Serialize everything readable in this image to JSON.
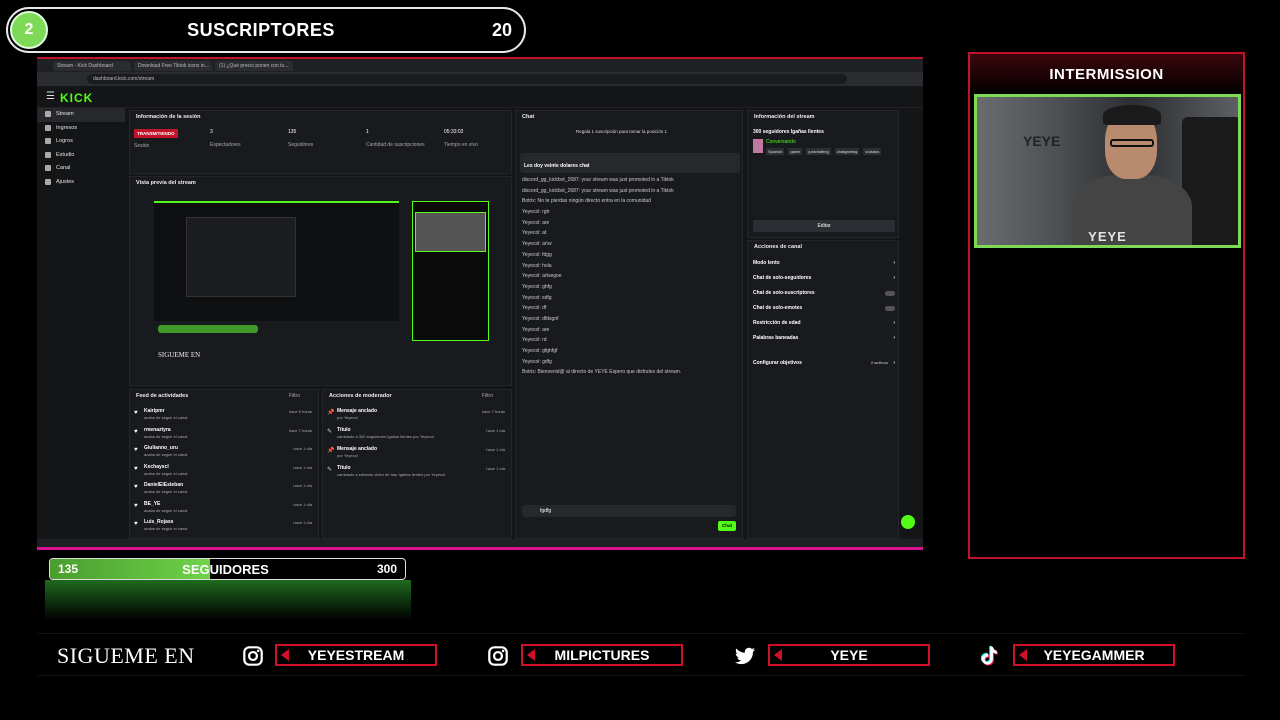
{
  "subscribers": {
    "current": "2",
    "title": "SUSCRIPTORES",
    "goal": "20"
  },
  "followers": {
    "current": "135",
    "title": "SEGUIDORES",
    "goal": "300",
    "progress_fraction": 0.45
  },
  "intermission": {
    "label": "INTERMISSION",
    "cam_brand": "YEYE"
  },
  "social": {
    "heading": "SIGUEME EN",
    "items": [
      {
        "platform_icon": "instagram-icon",
        "handle": "YEYESTREAM"
      },
      {
        "platform_icon": "instagram-icon",
        "handle": "MILPICTURES"
      },
      {
        "platform_icon": "twitter-icon",
        "handle": "YEYE"
      },
      {
        "platform_icon": "tiktok-icon",
        "handle": "YEYEGAMMER"
      }
    ]
  },
  "capture": {
    "tabs": [
      "Stream - Kick Dashboard",
      "Download Free Tiktok icons in...",
      "(1) ¿Qué precio ponen con tu..."
    ],
    "url": "dashboard.kick.com/stream",
    "logo": "KICK",
    "nav": [
      "Stream",
      "Ingresos",
      "Logros",
      "Estudio",
      "Canal",
      "Ajustes"
    ],
    "session": {
      "header": "Información de la sesión",
      "live_badge": "TRANSMITIENDO",
      "stats": [
        {
          "value": "3",
          "label": "Espectadores"
        },
        {
          "value": "135",
          "label": "Seguidores"
        },
        {
          "value": "1",
          "label": "Cantidad de suscripciones"
        },
        {
          "value": "05:33:02",
          "label": "Tiempo en vivo"
        }
      ],
      "session_label": "Sesión"
    },
    "preview_header": "Vista previa del stream",
    "preview_social": "SIGUEME EN",
    "feed": {
      "header": "Feed de actividades",
      "filter": "Filtro",
      "items": [
        {
          "user": "Kairipmr",
          "action": "acaba de seguir el canal",
          "time": "hace 6 horas"
        },
        {
          "user": "rmenaztyra",
          "action": "acaba de seguir el canal",
          "time": "hace 7 horas"
        },
        {
          "user": "Giulianno_uru",
          "action": "acaba de seguir el canal",
          "time": "hace 1 día"
        },
        {
          "user": "Kechayscl",
          "action": "acaba de seguir el canal",
          "time": "hace 1 día"
        },
        {
          "user": "DanielElEsteban",
          "action": "acaba de seguir el canal",
          "time": "hace 1 día"
        },
        {
          "user": "BE_YE",
          "action": "acaba de seguir el canal",
          "time": "hace 1 día"
        },
        {
          "user": "Luis_Rojass",
          "action": "acaba de seguir el canal",
          "time": "hace 1 día"
        }
      ]
    },
    "mod": {
      "header": "Acciones de moderador",
      "filter": "Filtro",
      "items": [
        {
          "title": "Mensaje anclado",
          "detail": "por Yeyecol",
          "time": "hace 7 horas"
        },
        {
          "title": "Título",
          "detail": "cambiado a 300 seguidores Igañas llentes por Yeyecol",
          "time": "hace 1 día"
        },
        {
          "title": "Mensaje anclado",
          "detail": "por Yeyecol",
          "time": "hace 1 día"
        },
        {
          "title": "Título",
          "detail": "cambiado a edtando video de trap Igañas llentes por Yeyecol",
          "time": "hace 1 día"
        }
      ]
    },
    "chat": {
      "header": "Chat",
      "pinned": "Regala 1 suscripción para tomar la posición 1",
      "pinned_msg": "Les doy veinte dolares chat",
      "lines": [
        "discord_gg_kickbot_2687: your stream was just promoted in a Tiktok",
        "discord_gg_kickbot_2687: your stream was just promoted in a Tiktok",
        "Botrix: No te pierdas ningún directo entra en la comunidad",
        "Yeyecol: rgtr",
        "Yeyecol: are",
        "Yeyecol: at",
        "Yeyecol: ar\\w",
        "Yeyecol: fdgg",
        "Yeyecol: hola",
        "Yeyecol: artsegoe",
        "Yeyecol: ghfg",
        "Yeyecol: sdfg",
        "Yeyecol: df",
        "Yeyecol: dfdsgnf",
        "Yeyecol: are",
        "Yeyecol: rd",
        "Yeyecol: gfghfgf",
        "Yeyecol: gdfg",
        "Botrix: Bienvenid@ al directo de YEYE Espero que disfrutes del stream."
      ],
      "input_value": "fgdfg",
      "send_label": "Chat"
    },
    "stream_info": {
      "header": "Información del stream",
      "title": "300 seguidores Igañas llentes",
      "category": "Conversando",
      "tags": [
        "Spanish",
        "game",
        "justchatting",
        "chatgaming",
        "volados"
      ],
      "edit_label": "Editar"
    },
    "channel_actions": {
      "header": "Acciones de canal",
      "items": [
        "Modo lento",
        "Chat de solo-seguidores",
        "Chat de solo-suscriptores",
        "Chat de solo-emotes",
        "Restricción de edad",
        "Palabras baneadas",
        "Configurar objetivos"
      ],
      "objectives_status": "2 activos"
    }
  },
  "colors": {
    "accent_green": "#53fc18",
    "frame_red": "#c0142a",
    "frame_pink": "#d9108f"
  }
}
